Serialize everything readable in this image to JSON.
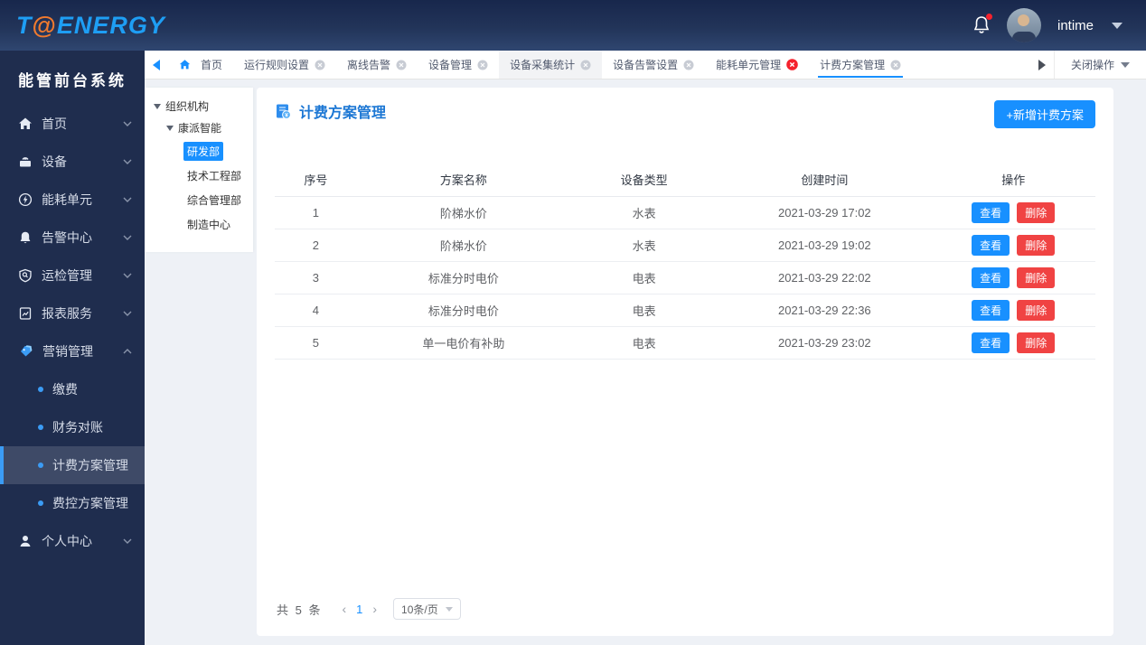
{
  "colors": {
    "accent": "#1890ff",
    "danger": "#f04343",
    "sidebar_bg": "#1f2d4e",
    "header_top": "#18274c",
    "title_blue": "#1c77d4",
    "selected_tree": "#1890ff"
  },
  "header": {
    "logo_t": "T",
    "logo_at": "@",
    "logo_rest": "ENERGY",
    "username": "intime"
  },
  "sidebar": {
    "title": "能管前台系统",
    "items": [
      {
        "label": "首页"
      },
      {
        "label": "设备"
      },
      {
        "label": "能耗单元"
      },
      {
        "label": "告警中心"
      },
      {
        "label": "运检管理"
      },
      {
        "label": "报表服务"
      },
      {
        "label": "营销管理"
      },
      {
        "label": "个人中心"
      }
    ],
    "marketing_children": [
      {
        "label": "缴费"
      },
      {
        "label": "财务对账"
      },
      {
        "label": "计费方案管理",
        "selected": true
      },
      {
        "label": "费控方案管理"
      }
    ]
  },
  "tabbar": {
    "tabs": [
      {
        "label": "首页"
      },
      {
        "label": "运行规则设置"
      },
      {
        "label": "离线告警"
      },
      {
        "label": "设备管理"
      },
      {
        "label": "设备采集统计"
      },
      {
        "label": "设备告警设置"
      },
      {
        "label": "能耗单元管理"
      },
      {
        "label": "计费方案管理",
        "active": true
      }
    ],
    "close_menu": "关闭操作"
  },
  "tree": {
    "root": "组织机构",
    "company": "康派智能",
    "nodes": [
      {
        "label": "研发部",
        "selected": true
      },
      {
        "label": "技术工程部"
      },
      {
        "label": "综合管理部"
      },
      {
        "label": "制造中心"
      }
    ]
  },
  "main": {
    "title": "计费方案管理",
    "add_button": "+新增计费方案",
    "table": {
      "columns": [
        "序号",
        "方案名称",
        "设备类型",
        "创建时间",
        "操作"
      ],
      "rows": [
        [
          "1",
          "阶梯水价",
          "水表",
          "2021-03-29  17:02"
        ],
        [
          "2",
          "阶梯水价",
          "水表",
          "2021-03-29  19:02"
        ],
        [
          "3",
          "标准分时电价",
          "电表",
          "2021-03-29  22:02"
        ],
        [
          "4",
          "标准分时电价",
          "电表",
          "2021-03-29  22:36"
        ],
        [
          "5",
          "单一电价有补助",
          "电表",
          "2021-03-29  23:02"
        ]
      ],
      "view_label": "查看",
      "delete_label": "删除"
    },
    "pagination": {
      "total": "共 5 条",
      "prev": "‹",
      "page": "1",
      "next": "›",
      "page_size": "10条/页"
    }
  }
}
